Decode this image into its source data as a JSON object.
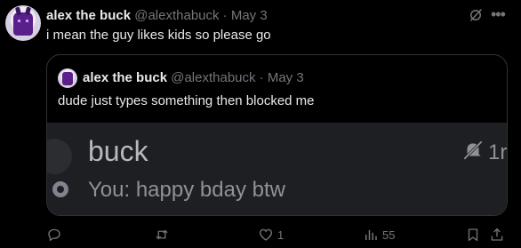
{
  "post": {
    "display_name": "alex the buck",
    "handle": "@alexthabuck",
    "separator": "·",
    "date": "May 3",
    "text": "i mean the guy likes kids so please go"
  },
  "quote": {
    "display_name": "alex the buck",
    "handle": "@alexthabuck",
    "separator": "·",
    "date": "May 3",
    "text": "dude just types something then blocked me",
    "media": {
      "dm_name": "buck",
      "dm_preview": "You: happy bday btw",
      "dm_time": "1r"
    }
  },
  "actions": {
    "reply_count": "",
    "repost_count": "",
    "like_count": "1",
    "views_count": "55"
  },
  "icons": {
    "more": "more-icon",
    "grok": "grok-icon",
    "reply": "reply-icon",
    "repost": "repost-icon",
    "like": "like-icon",
    "views": "views-icon",
    "bookmark": "bookmark-icon",
    "share": "share-icon",
    "mute": "mute-bell-icon"
  },
  "colors": {
    "background": "#000000",
    "text": "#e7e9ea",
    "muted": "#71767b",
    "border": "#2f3336",
    "discord_bg": "#1e1f22"
  }
}
